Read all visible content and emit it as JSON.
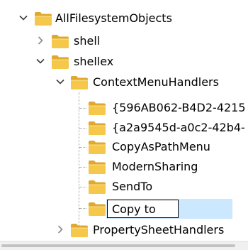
{
  "tree": {
    "items": [
      {
        "label": "AllFilesystemObjects",
        "state": "expanded"
      },
      {
        "label": "shell",
        "state": "collapsed"
      },
      {
        "label": "shellex",
        "state": "expanded"
      },
      {
        "label": "ContextMenuHandlers",
        "state": "expanded"
      },
      {
        "label": "{596AB062-B4D2-4215",
        "state": "leaf"
      },
      {
        "label": "{a2a9545d-a0c2-42b4-",
        "state": "leaf"
      },
      {
        "label": "CopyAsPathMenu",
        "state": "leaf"
      },
      {
        "label": "ModernSharing",
        "state": "leaf"
      },
      {
        "label": "SendTo",
        "state": "leaf"
      },
      {
        "label": "Copy to",
        "state": "editing"
      },
      {
        "label": "PropertySheetHandlers",
        "state": "collapsed"
      }
    ]
  },
  "colors": {
    "folder": "#f5c84c",
    "folder_dark": "#e0a82e",
    "selection": "#cce8ff"
  },
  "icons": {
    "expanded": "chevron-down-icon",
    "collapsed": "chevron-right-icon",
    "folder": "folder-icon"
  }
}
